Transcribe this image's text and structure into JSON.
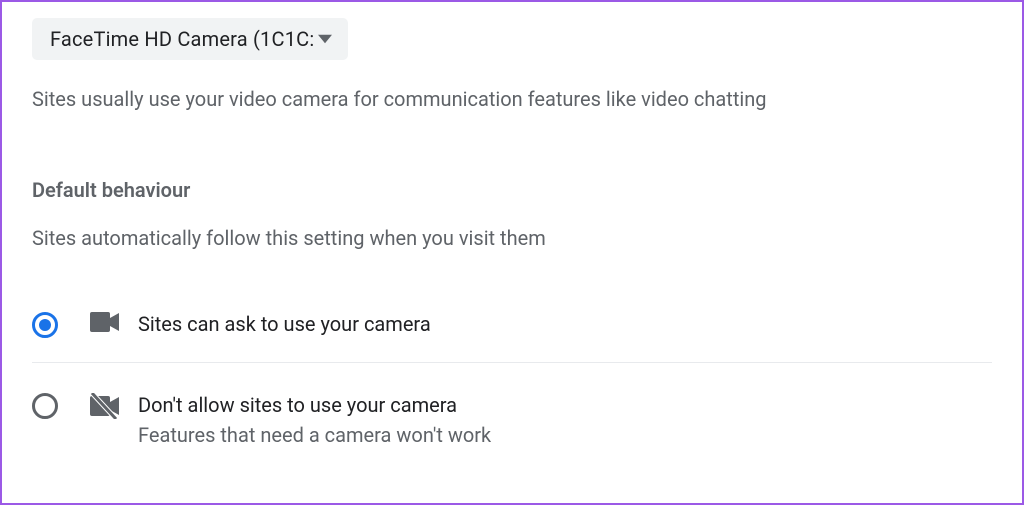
{
  "camera_select": {
    "selected_label": "FaceTime HD Camera (1C1C:"
  },
  "description": "Sites usually use your video camera for communication features like video chatting",
  "section": {
    "heading": "Default behaviour",
    "subtext": "Sites automatically follow this setting when you visit them"
  },
  "options": [
    {
      "label": "Sites can ask to use your camera",
      "selected": true
    },
    {
      "label": "Don't allow sites to use your camera",
      "sub": "Features that need a camera won't work",
      "selected": false
    }
  ]
}
